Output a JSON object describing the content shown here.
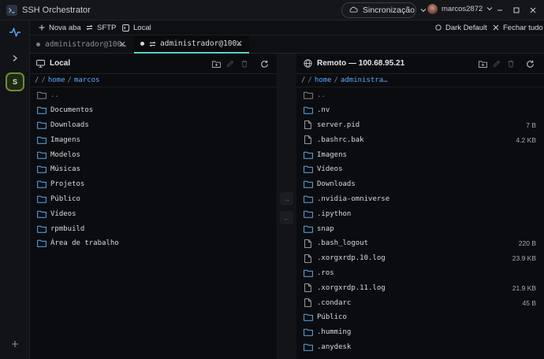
{
  "window": {
    "title": "SSH Orchestrator",
    "sync_label": "Sincronização",
    "user": "marcos2872"
  },
  "sidebar": {
    "session_initial": "S"
  },
  "toolbar": {
    "new_tab": "Nova aba",
    "sftp": "SFTP",
    "local": "Local",
    "theme": "Dark Default",
    "close_all": "Fechar tudo"
  },
  "tabs": [
    {
      "label": "administrador@100…",
      "active": false
    },
    {
      "label": "administrador@100…",
      "active": true
    }
  ],
  "local_pane": {
    "title": "Local",
    "breadcrumb": [
      "/",
      "home",
      "marcos"
    ],
    "items": [
      {
        "name": "..",
        "type": "parent"
      },
      {
        "name": "Documentos",
        "type": "folder"
      },
      {
        "name": "Downloads",
        "type": "folder"
      },
      {
        "name": "Imagens",
        "type": "folder"
      },
      {
        "name": "Modelos",
        "type": "folder"
      },
      {
        "name": "Músicas",
        "type": "folder"
      },
      {
        "name": "Projetos",
        "type": "folder"
      },
      {
        "name": "Público",
        "type": "folder"
      },
      {
        "name": "Vídeos",
        "type": "folder"
      },
      {
        "name": "rpmbuild",
        "type": "folder"
      },
      {
        "name": "Área de trabalho",
        "type": "folder"
      }
    ]
  },
  "remote_pane": {
    "title": "Remoto — 100.68.95.21",
    "breadcrumb": [
      "/",
      "home",
      "administra…"
    ],
    "items": [
      {
        "name": "..",
        "type": "parent",
        "size": ""
      },
      {
        "name": ".nv",
        "type": "folder",
        "size": ""
      },
      {
        "name": "server.pid",
        "type": "file",
        "size": "7 B"
      },
      {
        "name": ".bashrc.bak",
        "type": "file",
        "size": "4.2 KB"
      },
      {
        "name": "Imagens",
        "type": "folder",
        "size": ""
      },
      {
        "name": "Vídeos",
        "type": "folder",
        "size": ""
      },
      {
        "name": "Downloads",
        "type": "folder",
        "size": ""
      },
      {
        "name": ".nvidia-omniverse",
        "type": "folder",
        "size": ""
      },
      {
        "name": ".ipython",
        "type": "folder",
        "size": ""
      },
      {
        "name": "snap",
        "type": "folder",
        "size": ""
      },
      {
        "name": ".bash_logout",
        "type": "file",
        "size": "220 B"
      },
      {
        "name": ".xorgxrdp.10.log",
        "type": "file",
        "size": "23.9 KB"
      },
      {
        "name": ".ros",
        "type": "folder",
        "size": ""
      },
      {
        "name": ".xorgxrdp.11.log",
        "type": "file",
        "size": "21.9 KB"
      },
      {
        "name": ".condarc",
        "type": "file",
        "size": "45 B"
      },
      {
        "name": "Público",
        "type": "folder",
        "size": ""
      },
      {
        "name": ".humming",
        "type": "folder",
        "size": ""
      },
      {
        "name": ".anydesk",
        "type": "folder",
        "size": ""
      }
    ]
  },
  "transfer": {
    "upload_arrow": "→",
    "download_arrow": "←"
  },
  "colors": {
    "accent_tab": "#5fd0c8",
    "breadcrumb_link": "#5ea7ff",
    "folder_icon": "#5aa8e8",
    "session_badge": "#6f8c2e"
  }
}
